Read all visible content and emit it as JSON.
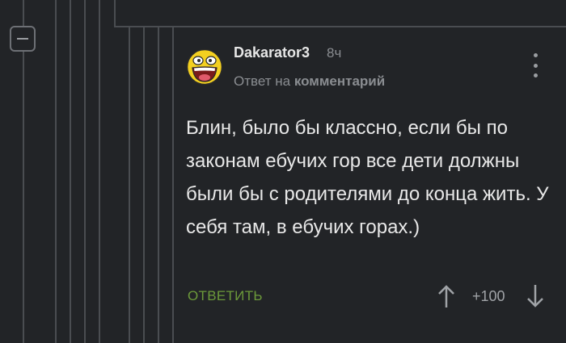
{
  "comment": {
    "author": "Dakarator3",
    "time": "8ч",
    "reply_prefix": "Ответ на",
    "reply_target": "комментарий",
    "text": "Блин, было бы классно, если бы по законам ебучих гор все дети должны были бы с родителями до конца жить. У себя там, в ебучих горах.)",
    "reply_label": "ОТВЕТИТЬ",
    "rating": "+100"
  },
  "icons": {
    "collapse": "minus-icon",
    "avatar": "awesome-face-avatar",
    "more": "vertical-dots-icon",
    "upvote": "arrow-up-icon",
    "downvote": "arrow-down-icon"
  },
  "colors": {
    "background": "#222427",
    "thread_line": "#4a4d51",
    "reply_button": "#6c9a3a",
    "muted_text": "#8a8d91"
  }
}
